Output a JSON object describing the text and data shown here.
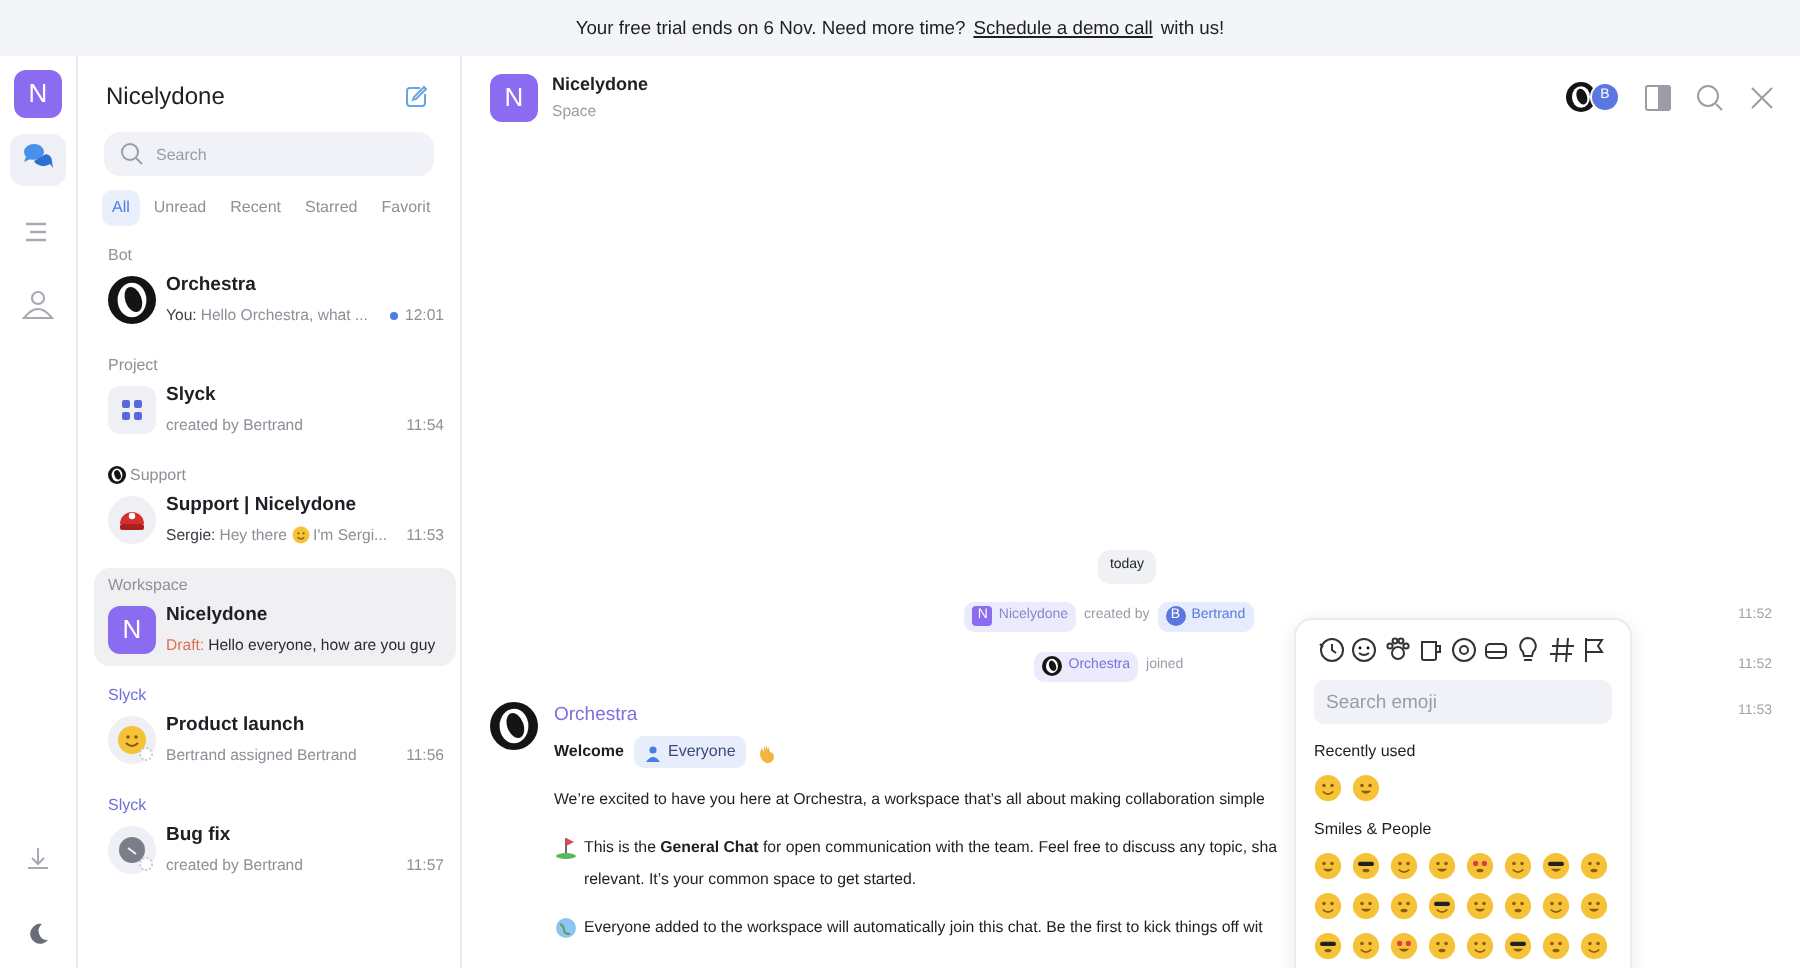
{
  "banner": {
    "text": "Your free trial ends on 6 Nov. Need more time?",
    "link": "Schedule a demo call",
    "after": "with us!"
  },
  "rail": {
    "avatar": "N",
    "items": [
      {
        "kind": "chats",
        "selected": true
      },
      {
        "kind": "list",
        "selected": false
      },
      {
        "kind": "contacts",
        "selected": false
      }
    ],
    "bottom": [
      {
        "kind": "download"
      },
      {
        "kind": "moon"
      }
    ]
  },
  "sidebar": {
    "title": "Nicelydone",
    "search": {
      "placeholder": "Search"
    },
    "filters": [
      {
        "label": "All",
        "selected": true
      },
      {
        "label": "Unread",
        "selected": false
      },
      {
        "label": "Recent",
        "selected": false
      },
      {
        "label": "Starred",
        "selected": false
      },
      {
        "label": "Favorit",
        "selected": false
      }
    ],
    "conversations": [
      {
        "group": {
          "label": "Bot",
          "icon": false,
          "color": "#8e9099"
        },
        "avatar": {
          "kind": "logo"
        },
        "name": "Orchestra",
        "preview": [
          {
            "kind": "sender",
            "text": "You:"
          },
          {
            "kind": "text",
            "text": "Hello Orchestra, what ..."
          }
        ],
        "unread": true,
        "time": "12:01",
        "selected": false
      },
      {
        "group": {
          "label": "Project",
          "icon": false,
          "color": "#8e9099"
        },
        "avatar": {
          "kind": "grid"
        },
        "name": "Slyck",
        "preview": [
          {
            "kind": "text",
            "text": "created by Bertrand"
          }
        ],
        "unread": false,
        "time": "11:54",
        "selected": false
      },
      {
        "group": {
          "label": "Support",
          "icon": true,
          "color": "#8e9099"
        },
        "avatar": {
          "kind": "robot"
        },
        "name": "Support | Nicelydone",
        "preview": [
          {
            "kind": "sender",
            "text": "Sergie:"
          },
          {
            "kind": "text",
            "text": "Hey there"
          },
          {
            "kind": "emoji"
          },
          {
            "kind": "text",
            "text": "I'm Sergi..."
          }
        ],
        "unread": false,
        "time": "11:53",
        "selected": false
      },
      {
        "group": {
          "label": "Workspace",
          "icon": false,
          "color": "#8e9099"
        },
        "avatar": {
          "kind": "letter",
          "letter": "N"
        },
        "name": "Nicelydone",
        "preview": [
          {
            "kind": "draft",
            "text": "Draft:"
          },
          {
            "kind": "strong",
            "text": "Hello everyone, how are you guy"
          }
        ],
        "unread": false,
        "selected": true
      },
      {
        "group": {
          "label": "Slyck",
          "icon": false,
          "color": "#6a6fd6"
        },
        "avatar": {
          "kind": "smile"
        },
        "name": "Product launch",
        "preview": [
          {
            "kind": "text",
            "text": "Bertrand assigned Bertrand"
          }
        ],
        "unread": false,
        "time": "11:56",
        "selected": false
      },
      {
        "group": {
          "label": "Slyck",
          "icon": false,
          "color": "#6a6fd6"
        },
        "avatar": {
          "kind": "bug"
        },
        "name": "Bug fix",
        "preview": [
          {
            "kind": "text",
            "text": "created by Bertrand"
          }
        ],
        "unread": false,
        "time": "11:57",
        "selected": false
      }
    ]
  },
  "header": {
    "avatar": "N",
    "title": "Nicelydone",
    "subtitle": "Space",
    "members": [
      {
        "kind": "logo"
      },
      {
        "kind": "letter",
        "letter": "B"
      }
    ]
  },
  "chat": {
    "date": "today",
    "events": [
      {
        "parts": [
          {
            "kind": "space",
            "avatar": "N",
            "text": "Nicelydone"
          },
          {
            "kind": "text",
            "text": "created by"
          },
          {
            "kind": "user",
            "avatar": "B",
            "text": "Bertrand"
          }
        ],
        "time": "11:52"
      },
      {
        "parts": [
          {
            "kind": "bot",
            "text": "Orchestra"
          },
          {
            "kind": "text",
            "text": "joined"
          }
        ],
        "time": "11:52"
      }
    ],
    "message": {
      "author": "Orchestra",
      "time": "11:53",
      "greeting": "Welcome",
      "mention": "Everyone",
      "paragraphs": [
        {
          "lines": [
            "We’re excited to have you here at Orchestra, a workspace that’s all about making collaboration simple"
          ]
        },
        {
          "lines": [
            "This is the **General Chat** for open communication with the team. Feel free to discuss any topic, sha",
            "relevant. It’s your common space to get started."
          ]
        },
        {
          "lines": [
            "Everyone added to the workspace will automatically join this chat. Be the first to kick things off wit"
          ]
        }
      ]
    }
  },
  "emoji_picker": {
    "search": {
      "placeholder": "Search emoji"
    },
    "sections": [
      {
        "title": "Recently used"
      },
      {
        "title": "Smiles & People"
      }
    ]
  }
}
